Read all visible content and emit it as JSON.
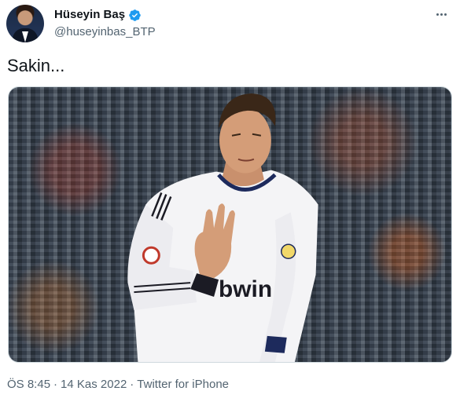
{
  "author": {
    "display_name": "Hüseyin Baş",
    "handle": "@huseyinbas_BTP",
    "verified": true,
    "avatar_icon": "profile-avatar"
  },
  "menu_icon": "more-dots-icon",
  "tweet": {
    "text": "Sakin...",
    "media_description_icon": "photo",
    "jersey_text": "bwin"
  },
  "meta": {
    "time": "ÖS 8:45",
    "separator": "·",
    "date": "14 Kas 2022",
    "source": "Twitter for iPhone"
  },
  "colors": {
    "verified_blue": "#1d9bf0",
    "secondary_text": "#536471",
    "primary_text": "#0f1419"
  }
}
